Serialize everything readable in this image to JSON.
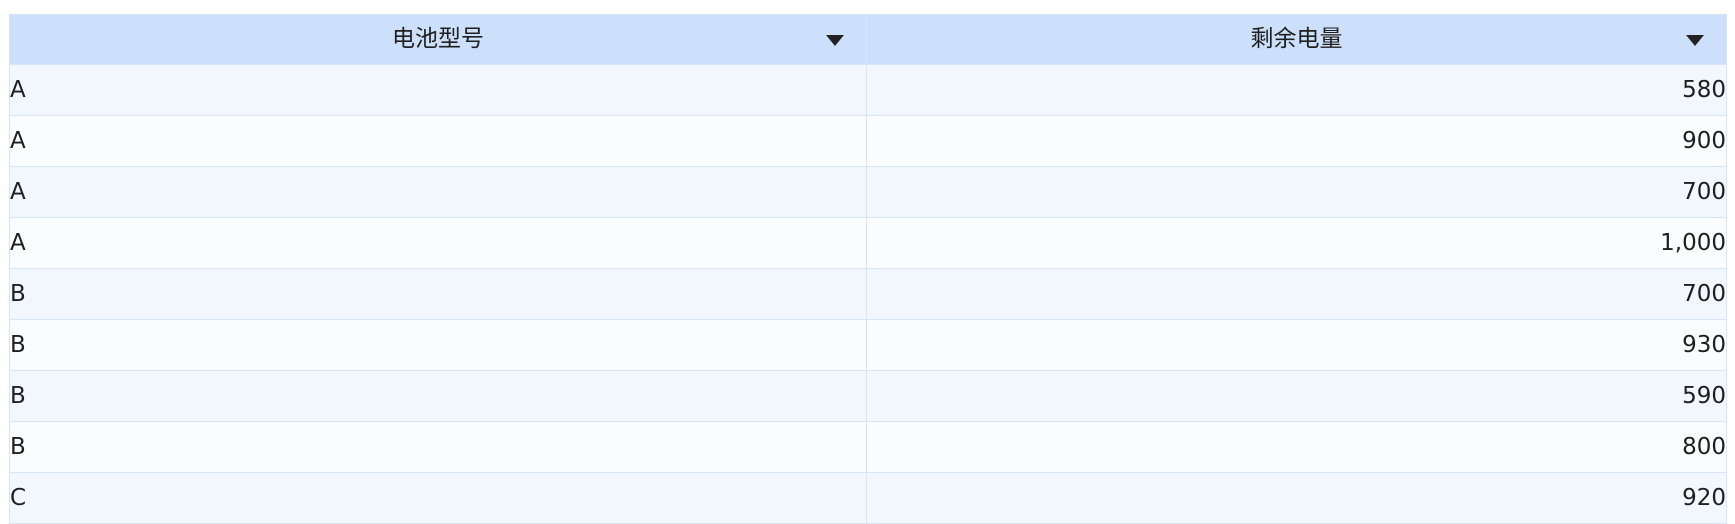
{
  "table": {
    "columns": [
      {
        "label": "电池型号",
        "filter_icon": "dropdown-triangle-icon"
      },
      {
        "label": "剩余电量",
        "filter_icon": "dropdown-triangle-icon"
      }
    ],
    "rows": [
      {
        "model": "A",
        "remaining": "580"
      },
      {
        "model": "A",
        "remaining": "900"
      },
      {
        "model": "A",
        "remaining": "700"
      },
      {
        "model": "A",
        "remaining": "1,000"
      },
      {
        "model": "B",
        "remaining": "700"
      },
      {
        "model": "B",
        "remaining": "930"
      },
      {
        "model": "B",
        "remaining": "590"
      },
      {
        "model": "B",
        "remaining": "800"
      },
      {
        "model": "C",
        "remaining": "920"
      }
    ]
  },
  "colors": {
    "header_bg": "#cde0fb",
    "row_odd_bg": "#f2f6fd",
    "row_even_bg": "#fafcff",
    "grid_line": "#d7e6f7"
  }
}
